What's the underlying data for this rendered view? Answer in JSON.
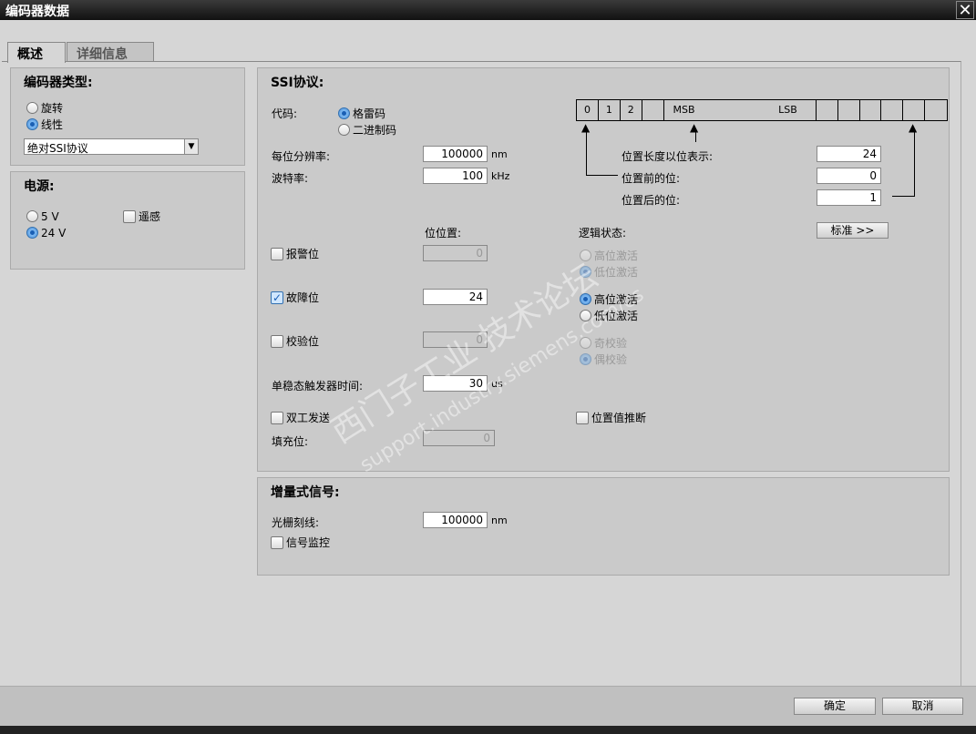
{
  "window": {
    "title": "编码器数据",
    "close": "✕"
  },
  "tabs": [
    {
      "label": "概述"
    },
    {
      "label": "详细信息"
    }
  ],
  "encoder_type": {
    "title": "编码器类型:",
    "options": [
      "旋转",
      "线性"
    ],
    "selected": "线性",
    "dropdown_value": "绝对SSI协议"
  },
  "power": {
    "title": "电源:",
    "options": [
      "5 V",
      "24 V"
    ],
    "selected": "24 V",
    "remote_sense_label": "遥感",
    "remote_sense_checked": false
  },
  "ssi": {
    "title": "SSI协议:",
    "code_label": "代码:",
    "code_options": [
      "格雷码",
      "二进制码"
    ],
    "code_selected": "格雷码",
    "resolution_label": "每位分辨率:",
    "resolution_value": "100000",
    "resolution_unit": "nm",
    "baud_label": "波特率:",
    "baud_value": "100",
    "baud_unit": "kHz",
    "bits": [
      "0",
      "1",
      "2",
      "",
      "MSB",
      "LSB",
      "",
      "",
      "",
      "",
      "",
      ""
    ],
    "pos_length_label": "位置长度以位表示:",
    "pos_length_value": "24",
    "bits_before_label": "位置前的位:",
    "bits_before_value": "0",
    "bits_after_label": "位置后的位:",
    "bits_after_value": "1",
    "bit_position_header": "位位置:",
    "logic_state_header": "逻辑状态:",
    "standard_button": "标准 >>",
    "alarm_label": "报警位",
    "alarm_checked": false,
    "alarm_value": "0",
    "alarm_options": [
      "高位激活",
      "低位激活"
    ],
    "fault_label": "故障位",
    "fault_checked": true,
    "fault_value": "24",
    "fault_options": [
      "高位激活",
      "低位激活"
    ],
    "parity_label": "校验位",
    "parity_checked": false,
    "parity_value": "0",
    "parity_options": [
      "奇校验",
      "偶校验"
    ],
    "monoflop_label": "单稳态触发器时间:",
    "monoflop_value": "30",
    "monoflop_unit": "us",
    "duplex_label": "双工发送",
    "duplex_checked": false,
    "fill_label": "填充位:",
    "fill_value": "0",
    "extrapolate_label": "位置值推断",
    "extrapolate_checked": false
  },
  "incremental": {
    "title": "增量式信号:",
    "grating_label": "光栅刻线:",
    "grating_value": "100000",
    "grating_unit": "nm",
    "monitor_label": "信号监控",
    "monitor_checked": false
  },
  "footer": {
    "ok": "确定",
    "cancel": "取消"
  },
  "watermark": {
    "line1": "西门子工业 技术论坛",
    "line2": "support.industry.siemens.com/cs"
  }
}
